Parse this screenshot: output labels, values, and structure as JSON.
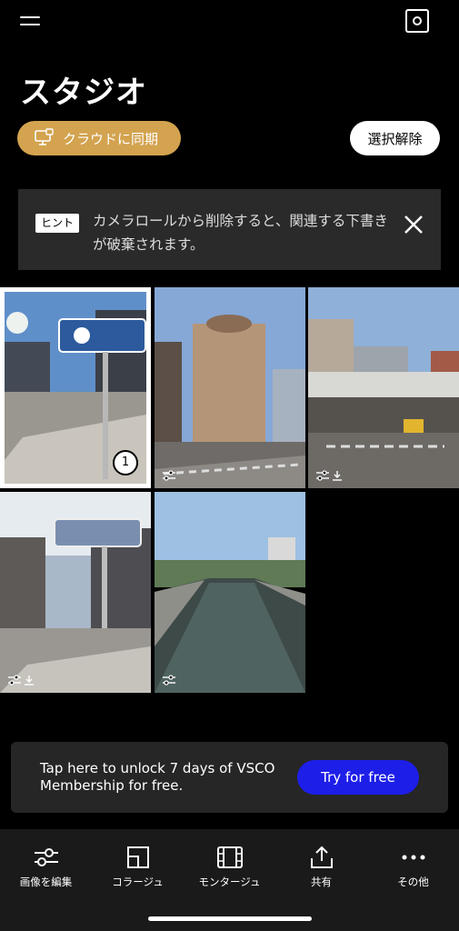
{
  "header": {
    "title": "スタジオ"
  },
  "actions": {
    "cloud_sync_label": "クラウドに同期",
    "deselect_label": "選択解除"
  },
  "hint": {
    "badge": "ヒント",
    "text": "カメラロールから削除すると、関連する下書きが破棄されます。"
  },
  "photos": [
    {
      "selected": true,
      "selection_number": "1",
      "edited": false,
      "downloaded": false
    },
    {
      "selected": false,
      "edited": true,
      "downloaded": false
    },
    {
      "selected": false,
      "edited": true,
      "downloaded": true
    },
    {
      "selected": false,
      "edited": true,
      "downloaded": true
    },
    {
      "selected": false,
      "edited": true,
      "downloaded": false
    }
  ],
  "promo": {
    "text": "Tap here to unlock 7 days of VSCO Membership for free.",
    "button_label": "Try for free"
  },
  "toolbar": {
    "items": [
      {
        "label": "画像を編集",
        "icon": "sliders-icon"
      },
      {
        "label": "コラージュ",
        "icon": "collage-icon"
      },
      {
        "label": "モンタージュ",
        "icon": "film-icon"
      },
      {
        "label": "共有",
        "icon": "share-icon"
      },
      {
        "label": "その他",
        "icon": "more-icon"
      }
    ]
  },
  "colors": {
    "accent_gold": "#d3a34f",
    "promo_blue": "#1d1ee8",
    "background": "#000000"
  }
}
